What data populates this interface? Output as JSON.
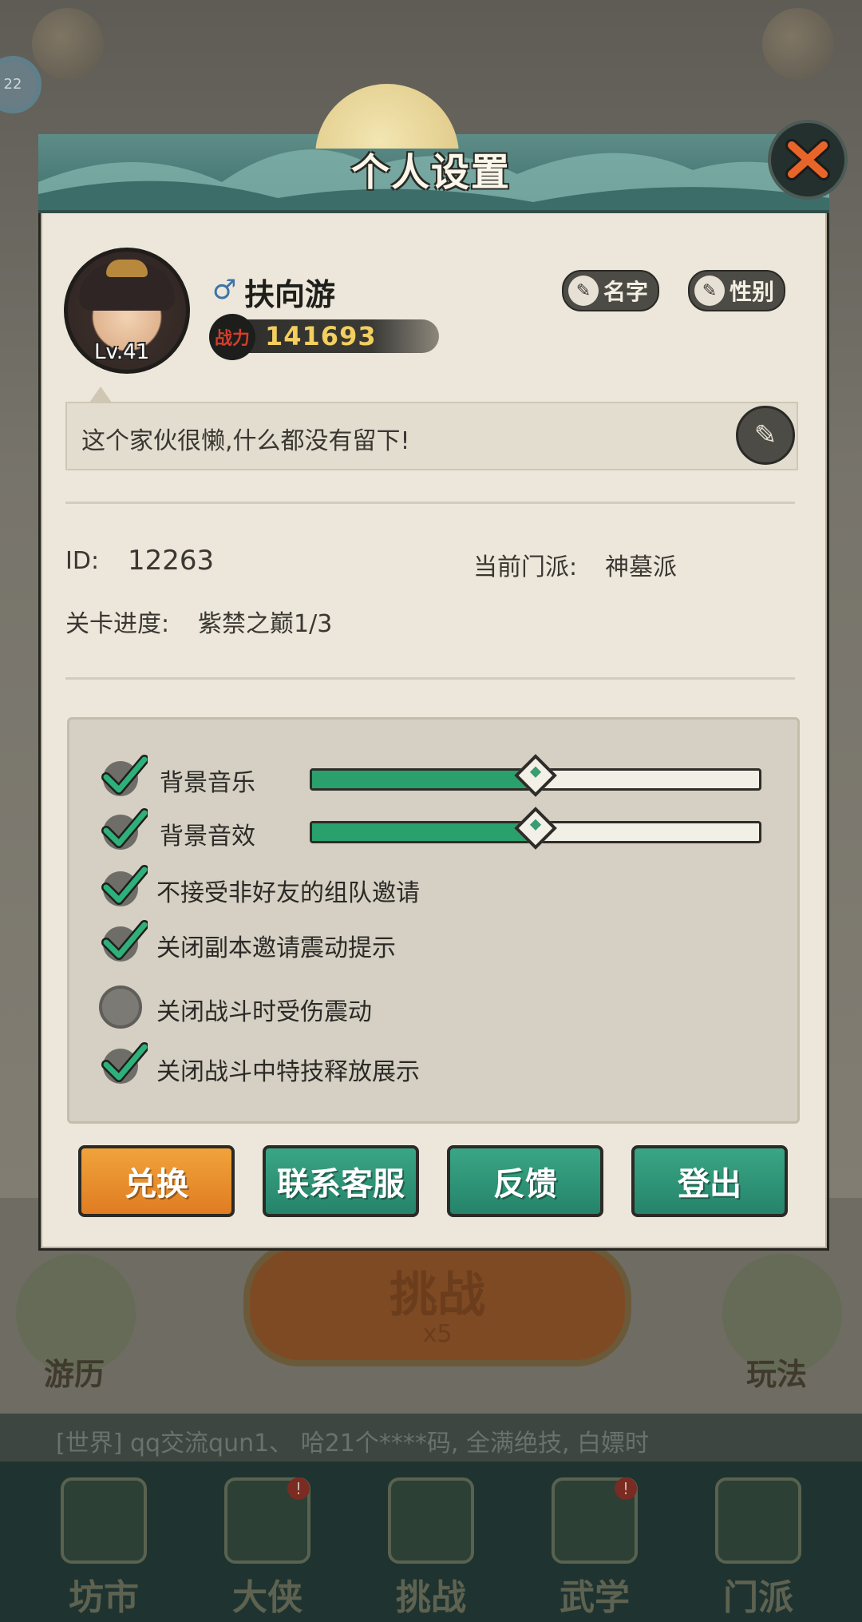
{
  "background": {
    "level_badge": "22",
    "challenge_label": "挑战",
    "challenge_cost": "x5",
    "left_label": "游历",
    "right_label": "玩法",
    "chat_text": "[世界] qq交流qun1、 哈21个****码, 全满绝技, 白嫖时",
    "nav": [
      {
        "label": "坊市",
        "badge": ""
      },
      {
        "label": "大侠",
        "badge": "!"
      },
      {
        "label": "挑战",
        "badge": ""
      },
      {
        "label": "武学",
        "badge": "!"
      },
      {
        "label": "门派",
        "badge": ""
      }
    ]
  },
  "dialog": {
    "title": "个人设置",
    "close_icon": "close-x-icon",
    "profile": {
      "level": "Lv.41",
      "gender_symbol": "♂",
      "name": "扶向游",
      "power_badge": "战力",
      "power": "141693",
      "rename_label": "名字",
      "gender_label": "性别"
    },
    "signature": "这个家伙很懒,什么都没有留下!",
    "info": {
      "id_label": "ID:",
      "id_value": "12263",
      "sect_label": "当前门派:",
      "sect_value": "神墓派",
      "stage_label": "关卡进度:",
      "stage_value": "紫禁之巅1/3"
    },
    "settings": [
      {
        "label": "背景音乐",
        "checked": true,
        "slider": 0.5
      },
      {
        "label": "背景音效",
        "checked": true,
        "slider": 0.5
      },
      {
        "label": "不接受非好友的组队邀请",
        "checked": true
      },
      {
        "label": "关闭副本邀请震动提示",
        "checked": true
      },
      {
        "label": "关闭战斗时受伤震动",
        "checked": false
      },
      {
        "label": "关闭战斗中特技释放展示",
        "checked": true
      }
    ],
    "buttons": {
      "redeem": "兑换",
      "support": "联系客服",
      "feedback": "反馈",
      "logout": "登出"
    },
    "colors": {
      "accent_green": "#2aa06d",
      "button_orange": "#e07c22",
      "button_green": "#25836a",
      "power_gold": "#f2cf5e"
    }
  }
}
